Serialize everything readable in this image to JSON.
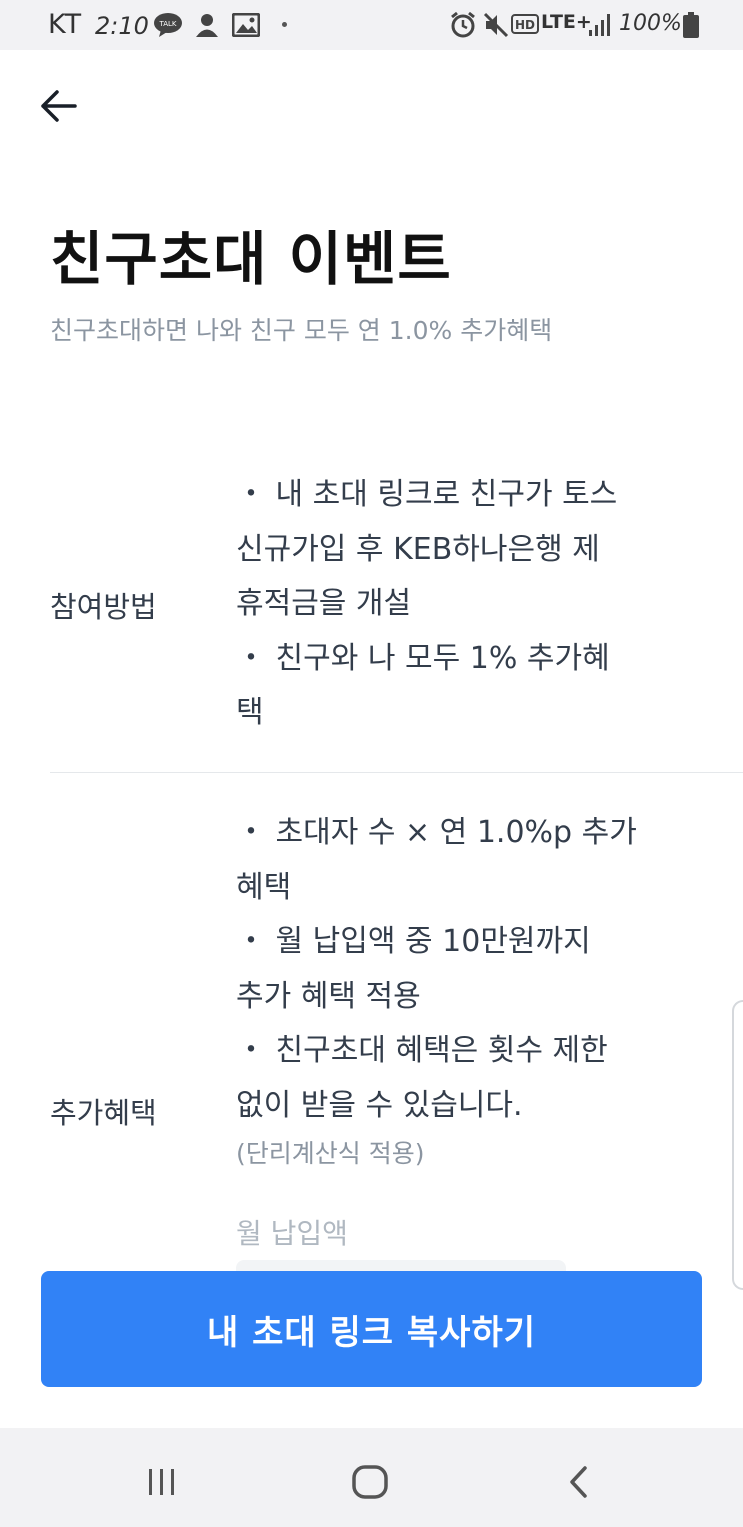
{
  "status_bar": {
    "carrier": "KT",
    "time": "2:10",
    "battery": "100%",
    "network": "LTE+"
  },
  "header": {
    "back_icon": "arrow-left-icon"
  },
  "title": "친구초대 이벤트",
  "subtitle": "친구초대하면 나와 친구 모두 연 1.0% 추가혜택",
  "rows": [
    {
      "label": "참여방법",
      "lines": [
        "・ 내 초대 링크로 친구가 토스",
        "신규가입 후 KEB하나은행 제",
        "휴적금을 개설",
        "・ 친구와 나 모두 1% 추가혜",
        "택"
      ]
    },
    {
      "label": "추가혜택",
      "lines": [
        "・ 초대자 수 × 연 1.0%p 추가",
        "혜택",
        "・ 월 납입액 중 10만원까지",
        "추가 혜택 적용",
        "・ 친구초대 혜택은 횟수 제한",
        "없이 받을 수 있습니다."
      ],
      "note": "(단리계산식 적용)",
      "field_label": "월 납입액"
    }
  ],
  "cta": {
    "label": "내 초대 링크 복사하기"
  },
  "nav": {
    "recents_icon": "recents-icon",
    "home_icon": "home-icon",
    "back_icon": "back-chevron-icon"
  },
  "colors": {
    "accent": "#3182f6",
    "text_primary": "#191f28",
    "text_secondary": "#8b95a1"
  }
}
